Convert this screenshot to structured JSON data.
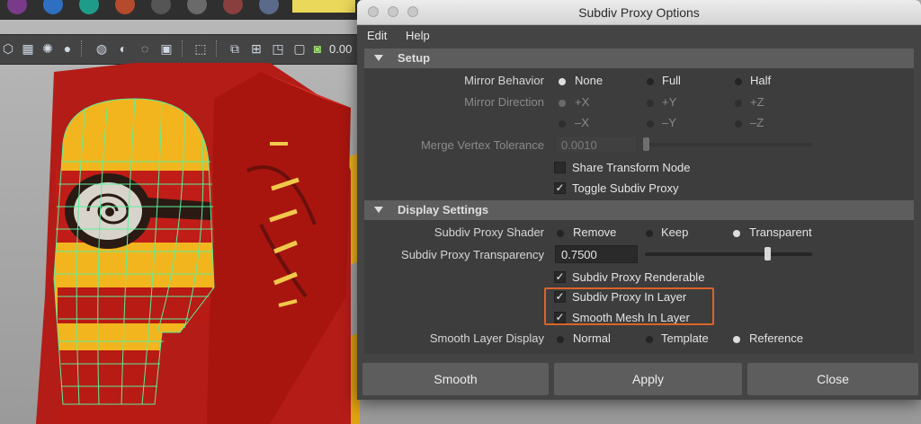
{
  "window": {
    "title": "Subdiv Proxy Options"
  },
  "menu": {
    "items": [
      "Edit",
      "Help"
    ]
  },
  "toolbar": {
    "value": "0.00"
  },
  "setup": {
    "header": "Setup",
    "mirror_behavior": {
      "label": "Mirror Behavior",
      "options": [
        "None",
        "Full",
        "Half"
      ],
      "selected": "None"
    },
    "mirror_direction": {
      "label": "Mirror Direction",
      "options": [
        "+X",
        "+Y",
        "+Z",
        "–X",
        "–Y",
        "–Z"
      ],
      "selected": "+X"
    },
    "merge_vertex_tolerance": {
      "label": "Merge Vertex Tolerance",
      "value": "0.0010",
      "slider_fraction": 0.0
    },
    "share_transform_node": {
      "label": "Share Transform Node",
      "checked": false
    },
    "toggle_subdiv_proxy": {
      "label": "Toggle Subdiv Proxy",
      "checked": true
    }
  },
  "display": {
    "header": "Display Settings",
    "subdiv_proxy_shader": {
      "label": "Subdiv Proxy Shader",
      "options": [
        "Remove",
        "Keep",
        "Transparent"
      ],
      "selected": "Transparent"
    },
    "subdiv_proxy_transparency": {
      "label": "Subdiv Proxy Transparency",
      "value": "0.7500",
      "slider_fraction": 0.75
    },
    "subdiv_proxy_renderable": {
      "label": "Subdiv Proxy Renderable",
      "checked": true
    },
    "subdiv_proxy_in_layer": {
      "label": "Subdiv Proxy In Layer",
      "checked": true
    },
    "smooth_mesh_in_layer": {
      "label": "Smooth Mesh In Layer",
      "checked": true
    },
    "smooth_layer_display": {
      "label": "Smooth Layer Display",
      "options": [
        "Normal",
        "Template",
        "Reference"
      ],
      "selected": "Reference"
    }
  },
  "buttons": {
    "smooth": "Smooth",
    "apply": "Apply",
    "close": "Close"
  },
  "colors": {
    "highlight": "#d9642a",
    "wireframe": "#5cf09a",
    "character_red": "#c01d18",
    "character_yellow": "#f2b51e"
  }
}
